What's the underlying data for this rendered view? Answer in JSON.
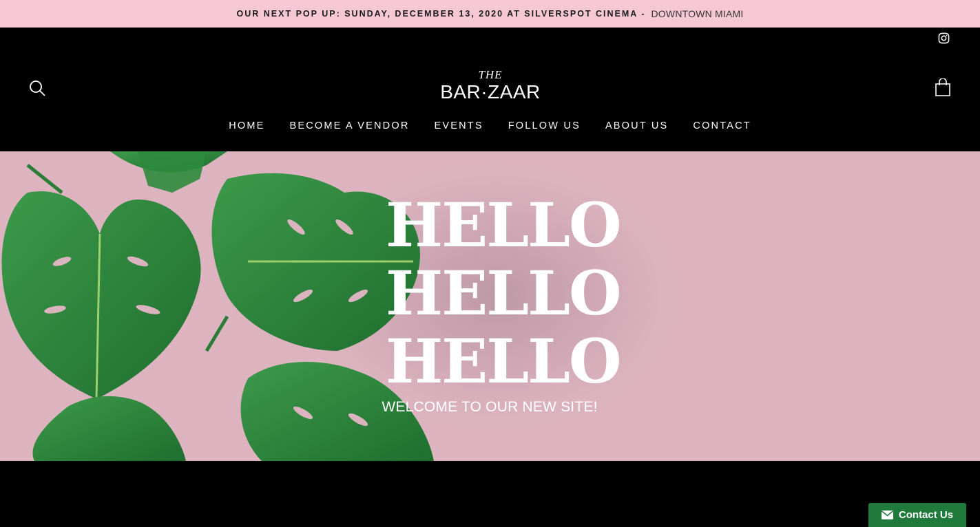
{
  "announcement": {
    "main": "OUR NEXT POP UP: SUNDAY, DECEMBER 13, 2020 AT SILVERSPOT CINEMA -",
    "location": "DOWNTOWN MIAMI"
  },
  "header": {
    "logo_top": "THE",
    "logo_name": "BAR·ZAAR",
    "icons": [
      "instagram-icon",
      "search-icon",
      "cart-icon"
    ]
  },
  "nav": {
    "items": [
      "HOME",
      "BECOME A VENDOR",
      "EVENTS",
      "FOLLOW US",
      "ABOUT US",
      "CONTACT"
    ]
  },
  "hero": {
    "lines": [
      "HELLO",
      "HELLO",
      "HELLO"
    ],
    "subtitle": "WELCOME TO OUR NEW SITE!"
  },
  "contact_widget": {
    "label": "Contact Us"
  },
  "colors": {
    "announcement_bg": "#f6c8d6",
    "hero_bg": "#dbb3bf",
    "leaf_green": "#2f8a3e",
    "contact_green": "#1f7a3c"
  }
}
